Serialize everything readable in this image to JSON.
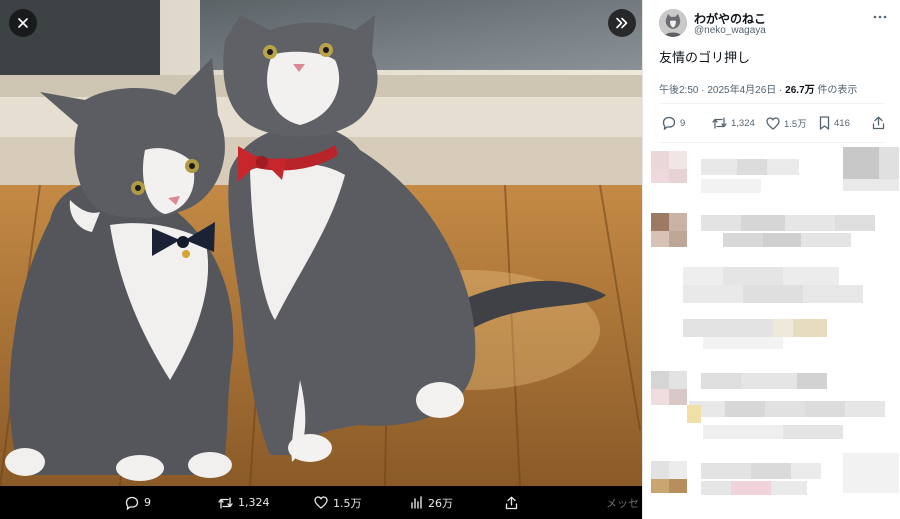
{
  "viewer": {
    "close_icon": "close-icon",
    "expand_icon": "chevron-double-right-icon",
    "actions": {
      "reply_count": "9",
      "retweet_count": "1,324",
      "like_count": "1.5万",
      "view_count": "26万",
      "right_edge_text": "メッセ"
    }
  },
  "tweet": {
    "display_name": "わがやのねこ",
    "handle": "@neko_wagaya",
    "text": "友情のゴリ押し",
    "meta_time": "午後2:50 · 2025年4月26日 · ",
    "meta_views": "26.7万",
    "meta_views_suffix": " 件の表示",
    "actions": {
      "reply_count": "9",
      "retweet_count": "1,324",
      "like_count": "1.5万",
      "bookmark_count": "416"
    }
  },
  "colors": {
    "panel_bg": "#ffffff",
    "text_primary": "#0f1419",
    "text_secondary": "#536471",
    "viewer_bg": "#000000"
  }
}
